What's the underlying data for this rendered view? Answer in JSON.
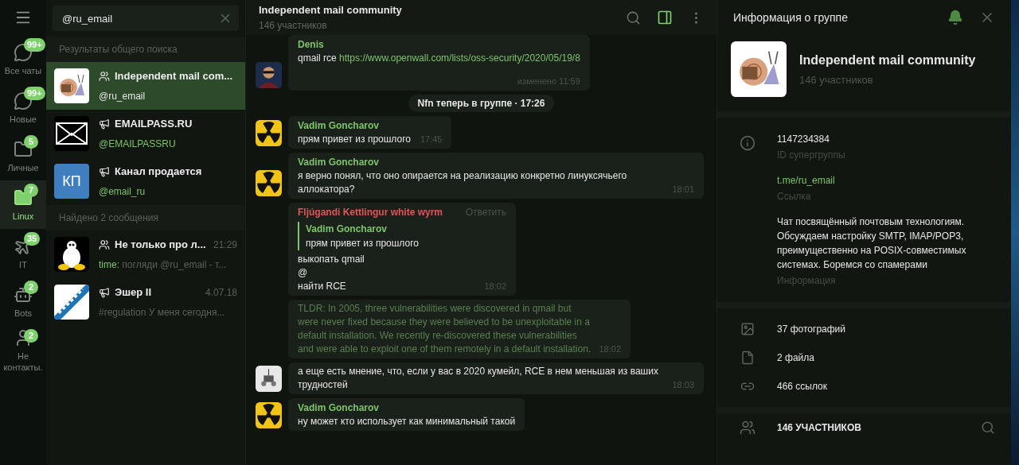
{
  "folders": [
    {
      "label": "Все чаты",
      "badge": "99+",
      "selected": false
    },
    {
      "label": "Новые",
      "badge": "99+",
      "selected": false
    },
    {
      "label": "Личные",
      "badge": "5",
      "selected": false
    },
    {
      "label": "Linux",
      "badge": "7",
      "selected": true
    },
    {
      "label": "IT",
      "badge": "35",
      "selected": false
    },
    {
      "label": "Bots",
      "badge": "2",
      "selected": false
    },
    {
      "label": "Не контакты.",
      "badge": "2",
      "selected": false
    }
  ],
  "search": {
    "value": "@ru_email"
  },
  "results": [
    {
      "kind": "header",
      "label": "Результаты общего поиска"
    },
    {
      "kind": "chat",
      "title": "Independent mail com...",
      "subtitle": "@ru_email",
      "selected": true
    },
    {
      "kind": "chat",
      "title": "EMAILPASS.RU",
      "subtitle": "@EMAILPASSRU",
      "selected": false
    },
    {
      "kind": "chat",
      "initials": "КП",
      "title": "Канал продается",
      "subtitle": "@email_ru",
      "selected": false
    },
    {
      "kind": "header",
      "label": "Найдено 2 сообщения"
    },
    {
      "kind": "message",
      "title": "Не только про л...",
      "time": "21:29",
      "author": "time:",
      "subtitle": "погляди @ru_email - т...",
      "selected": false
    },
    {
      "kind": "message",
      "title": "Эшер II",
      "time": "4.07.18",
      "subtitle": "#regulation У меня сегодня...",
      "selected": false
    }
  ],
  "chat": {
    "title": "Independent mail community",
    "subtitle": "146 участников",
    "messages": [
      {
        "kind": "message",
        "sender": "Denis",
        "color": "#7ec46c",
        "text": "qmail rce",
        "link": "https://www.openwall.com/lists/oss-security/2020/05/19/8",
        "time": "изменено 11:59"
      },
      {
        "kind": "service",
        "text": "Nfn теперь в группе · 17:26"
      },
      {
        "kind": "message",
        "sender": "Vadim Goncharov",
        "color": "#7ec46c",
        "text": "прям привет из прошлого",
        "time": "17:45"
      },
      {
        "kind": "message",
        "sender": "Vadim Goncharov",
        "color": "#7ec46c",
        "text": "я верно понял, что оно опирается на реализацию конкретно линуксячьего аллокатора?",
        "time": "18:01"
      },
      {
        "kind": "reply",
        "sender": "Fljúgandi Kettlingur white wyrm",
        "color": "#e0555a",
        "action": "Ответить",
        "quote_author": "Vadim Goncharov",
        "quote_text": "прям привет из прошлого",
        "lines": [
          "выкопать qmail",
          "@",
          "найти RCE"
        ],
        "time": "18:02"
      },
      {
        "kind": "faded",
        "text": "TLDR: In 2005, three vulnerabilities were discovered in qmail but were never fixed because they were believed to be unexploitable in a default installation. We recently re-discovered these vulnerabilities and were able to exploit one of them remotely in a default installation.",
        "time": "18:02"
      },
      {
        "kind": "message",
        "text": "а еще есть мнение, что, если у вас в 2020 кумейл, RCE в нем меньшая из ваших трудностей",
        "time": "18:03"
      },
      {
        "kind": "message",
        "sender": "Vadim Goncharov",
        "color": "#7ec46c",
        "text": "ну может кто использует как минимальный такой"
      }
    ]
  },
  "info": {
    "title": "Информация о группе",
    "name": "Independent mail community",
    "members": "146 участников",
    "fields": [
      {
        "value": "1147234384",
        "label": "ID супергруппы",
        "kind": "text"
      },
      {
        "value": "t.me/ru_email",
        "label": "Ссылка",
        "kind": "link"
      },
      {
        "value": "Чат посвящённый почтовым технологиям. Обсуждаем настройку SMTP, IMAP/POP3, преимущественно на POSIX-совместимых системах. Боремся со спамерами",
        "label": "Информация",
        "kind": "text"
      }
    ],
    "media": [
      {
        "label": "37 фотографий"
      },
      {
        "label": "2 файла"
      },
      {
        "label": "466 ссылок"
      }
    ],
    "members_header": "146 УЧАСТНИКОВ"
  }
}
